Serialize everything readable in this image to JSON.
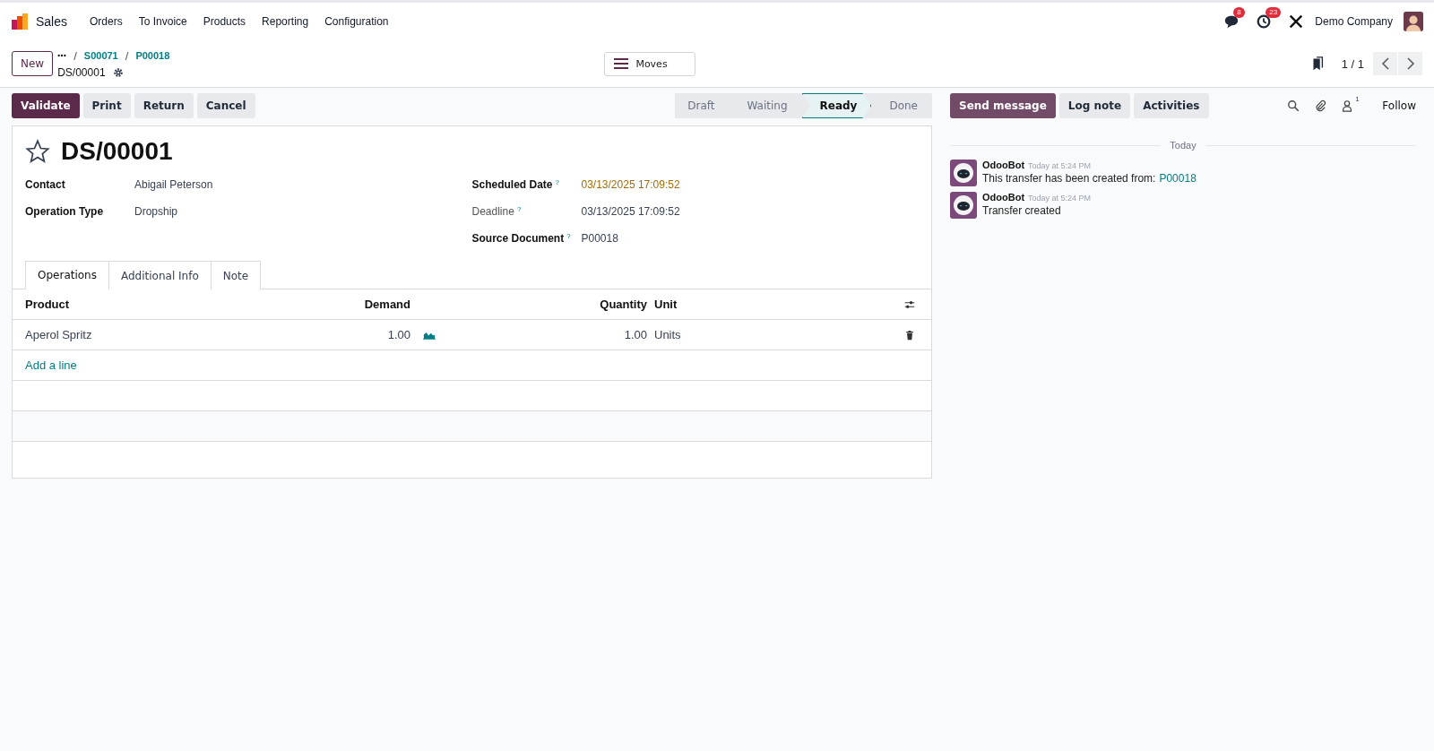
{
  "navbar": {
    "app": "Sales",
    "menu": [
      "Orders",
      "To Invoice",
      "Products",
      "Reporting",
      "Configuration"
    ],
    "messages_badge": "8",
    "activities_badge": "23",
    "company": "Demo Company"
  },
  "control_panel": {
    "new_button": "New",
    "breadcrumb_separator": "/",
    "breadcrumbs": [
      "S00071",
      "P00018"
    ],
    "record": "DS/00001",
    "moves_button": "Moves",
    "pager": "1 / 1"
  },
  "actions": [
    "Validate",
    "Print",
    "Return",
    "Cancel"
  ],
  "statuses": [
    {
      "label": "Draft",
      "selected": false
    },
    {
      "label": "Waiting",
      "selected": false
    },
    {
      "label": "Ready",
      "selected": true
    },
    {
      "label": "Done",
      "selected": false
    }
  ],
  "chatter_buttons": [
    "Send message",
    "Log note",
    "Activities"
  ],
  "followers_count": "1",
  "follow": "Follow",
  "form": {
    "title": "DS/00001",
    "starred": false,
    "left_fields": [
      {
        "label": "Contact",
        "value": "Abigail Peterson",
        "muted": false,
        "warning": false
      },
      {
        "label": "Operation Type",
        "value": "Dropship",
        "muted": false,
        "warning": false
      }
    ],
    "right_fields": [
      {
        "label": "Scheduled Date",
        "value": "03/13/2025 17:09:52",
        "help": "?",
        "muted": false,
        "warning": true
      },
      {
        "label": "Deadline",
        "value": "03/13/2025 17:09:52",
        "help": "?",
        "muted": true,
        "warning": false
      },
      {
        "label": "Source Document",
        "value": "P00018",
        "help": "?",
        "muted": false,
        "warning": false
      }
    ],
    "tabs": [
      {
        "label": "Operations",
        "selected": true
      },
      {
        "label": "Additional Info",
        "selected": false
      },
      {
        "label": "Note",
        "selected": false
      }
    ],
    "table": {
      "columns": [
        "Product",
        "Demand",
        "Quantity",
        "Unit"
      ],
      "rows": [
        {
          "product": "Aperol Spritz",
          "demand": "1.00",
          "quantity": "1.00",
          "unit": "Units"
        }
      ],
      "add_line": "Add a line"
    }
  },
  "chatter": {
    "date_separator": "Today",
    "messages": [
      {
        "author": "OdooBot",
        "time": "Today at 5:24 PM",
        "text": "This transfer has been created from:",
        "link": "P00018"
      },
      {
        "author": "OdooBot",
        "time": "Today at 5:24 PM",
        "text": "Transfer created"
      }
    ]
  }
}
